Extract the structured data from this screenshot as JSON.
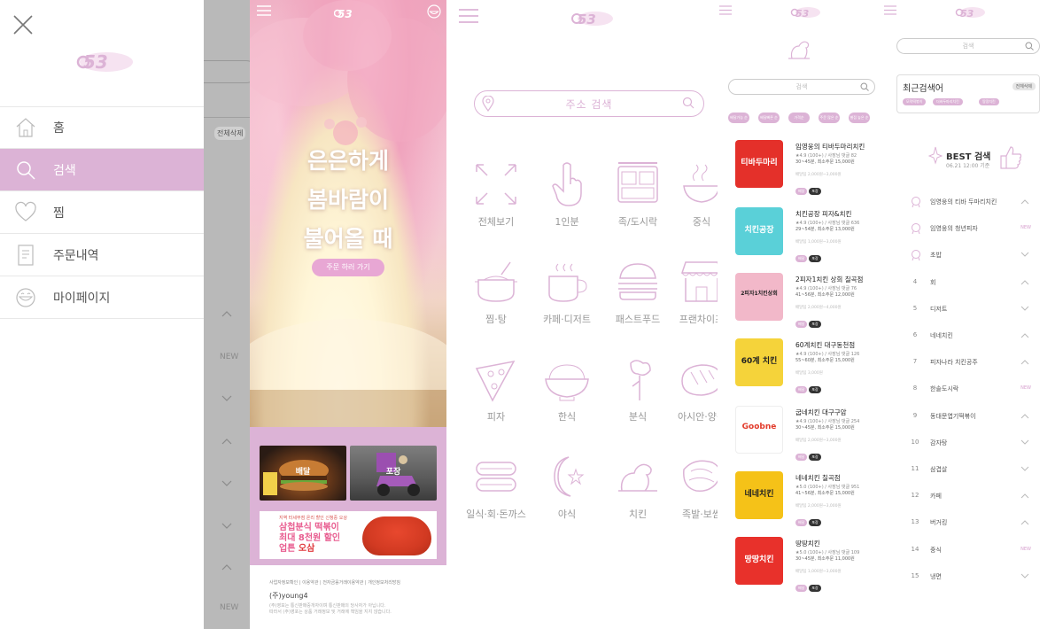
{
  "logo_text": "53",
  "side_menu": {
    "items": [
      {
        "label": "홈",
        "icon": "home-icon"
      },
      {
        "label": "검색",
        "icon": "search-icon",
        "active": true
      },
      {
        "label": "찜",
        "icon": "heart-icon"
      },
      {
        "label": "주문내역",
        "icon": "receipt-icon"
      },
      {
        "label": "마이페이지",
        "icon": "smile-icon"
      }
    ]
  },
  "overlay": {
    "delete_all": "전체삭제",
    "new1": "NEW",
    "new2": "NEW"
  },
  "promo": {
    "hero_line1": "은은하게",
    "hero_line2": "봄바람이",
    "hero_line3": "불어올 때",
    "cta": "주문 하러 가기",
    "tile_delivery": "배달",
    "tile_pickup": "포장",
    "banner_small": "지역 터세부점 온리 할인 신청중 오상",
    "banner_line1": "삼첩분식 떡볶이",
    "banner_line2": "최대 8천원 할인",
    "banner_line3a": "업튼 ",
    "banner_line3b": "오삼",
    "footer_links": "사업자정보확인  |  이용약관  |  전자금융거래이용약관  |  개인정보처리방침",
    "company": "(주)young4",
    "fine1": "(주)영포는 통신판매중개자이며 통신판매의 당사자가 아닙니다.",
    "fine2": "따라서 (주)영포는 상품 거래정보 및 거래에 책임을 지지 않습니다."
  },
  "categories": {
    "address_placeholder": "주소 검색",
    "items": [
      {
        "label": "전체보기",
        "icon": "expand-icon"
      },
      {
        "label": "1인분",
        "icon": "finger-icon"
      },
      {
        "label": "족/도시락",
        "icon": "lunchbox-icon"
      },
      {
        "label": "중식",
        "icon": "noodle-bowl-icon"
      },
      {
        "label": "찜·탕",
        "icon": "pot-icon"
      },
      {
        "label": "카페·디저트",
        "icon": "coffee-icon"
      },
      {
        "label": "패스트푸드",
        "icon": "burger-icon"
      },
      {
        "label": "프랜차이즈",
        "icon": "store-icon"
      },
      {
        "label": "피자",
        "icon": "pizza-icon"
      },
      {
        "label": "한식",
        "icon": "rice-bowl-icon"
      },
      {
        "label": "분식",
        "icon": "skewer-icon"
      },
      {
        "label": "아시안·양식",
        "icon": "bread-icon"
      },
      {
        "label": "일식·회·돈까스",
        "icon": "sushi-icon"
      },
      {
        "label": "야식",
        "icon": "moon-star-icon"
      },
      {
        "label": "치킨",
        "icon": "chicken-icon"
      },
      {
        "label": "족발·보쌈",
        "icon": "pork-icon"
      }
    ]
  },
  "list": {
    "search_placeholder": "검색",
    "chips": [
      "배달가능 순",
      "배달빠른 순",
      "가격순",
      "주문 많은 순",
      "별점 높은 순"
    ],
    "restaurants": [
      {
        "name": "임영웅의 티바두마리치킨",
        "thumb_text": "티바두마리",
        "rating": "★4.9 (100+) / 사장님 댓글 82",
        "meta1": "30~45분, 최소주문 15,000원",
        "meta2": "배달팁 2,000원~3,000원",
        "color": "#e4302a"
      },
      {
        "name": "치킨공장 피자&치킨",
        "thumb_text": "치킨공장",
        "rating": "★4.9 (100+) / 사장님 댓글 636",
        "meta1": "29~54분, 최소주문 13,000원",
        "meta2": "배달팁 1,000원~3,000원",
        "color": "#5ad0d8"
      },
      {
        "name": "2피자1치킨 상회 칠곡점",
        "thumb_text": "2피자1치킨상회",
        "rating": "★4.9 (100+) / 사장님 댓글 76",
        "meta1": "41~56분, 최소주문 12,000원",
        "meta2": "배달팁 2,000원~4,000원",
        "color": "#f2b8c9"
      },
      {
        "name": "60계치킨 대구동천점",
        "thumb_text": "60계 치킨",
        "rating": "★4.9 (100+) / 사장님 댓글 126",
        "meta1": "55~60분, 최소주문 15,000원",
        "meta2": "배달팁 3,000원",
        "color": "#f5d33a"
      },
      {
        "name": "굽네치킨 대구구암",
        "thumb_text": "Goobne",
        "rating": "★4.9 (100+) / 사장님 댓글 254",
        "meta1": "30~45분, 최소주문 15,000원",
        "meta2": "배달팁 2,000원~3,000원",
        "color": "#ffffff"
      },
      {
        "name": "네네치킨 칠곡점",
        "thumb_text": "네네치킨",
        "rating": "★5.0 (100+) / 사장님 댓글 951",
        "meta1": "41~56분, 최소주문 15,000원",
        "meta2": "배달팁 2,000원~3,000원",
        "color": "#f5c218"
      },
      {
        "name": "땅땅치킨",
        "thumb_text": "땅땅치킨",
        "rating": "★5.0 (100+) / 사장님 댓글 109",
        "meta1": "30~45분, 최소주문 11,000원",
        "meta2": "배달팁 1,000원~3,000원",
        "color": "#e8312b"
      }
    ],
    "tag1": "배달",
    "tag2": "포장"
  },
  "search": {
    "placeholder": "검색",
    "recent_title": "최근검색어",
    "delete_all": "전체삭제",
    "recent_keywords": [
      "모락떡볶이",
      "더바두마리치킨",
      "땅땅치킨"
    ],
    "best_title": "BEST 검색",
    "best_date": "06.21 12:00 기준",
    "ranking": [
      {
        "rank": "1",
        "label": "임영웅의 티바 두마리치킨",
        "trend": "up"
      },
      {
        "rank": "2",
        "label": "임영웅의 청년피자",
        "trend": "new"
      },
      {
        "rank": "3",
        "label": "초밥",
        "trend": "down"
      },
      {
        "rank": "4",
        "label": "회",
        "trend": "up"
      },
      {
        "rank": "5",
        "label": "디저트",
        "trend": "down"
      },
      {
        "rank": "6",
        "label": "네네치킨",
        "trend": "up"
      },
      {
        "rank": "7",
        "label": "피자나라 치킨공주",
        "trend": "up"
      },
      {
        "rank": "8",
        "label": "한솥도시락",
        "trend": "new"
      },
      {
        "rank": "9",
        "label": "동대문엽기떡볶이",
        "trend": "up"
      },
      {
        "rank": "10",
        "label": "감자탕",
        "trend": "down"
      },
      {
        "rank": "11",
        "label": "삼겹살",
        "trend": "down"
      },
      {
        "rank": "12",
        "label": "카페",
        "trend": "up"
      },
      {
        "rank": "13",
        "label": "버거킹",
        "trend": "up"
      },
      {
        "rank": "14",
        "label": "중식",
        "trend": "new"
      },
      {
        "rank": "15",
        "label": "냉면",
        "trend": "down"
      }
    ]
  },
  "colors": {
    "accent": "#dcb3d6",
    "new": "#d7a0cf"
  }
}
